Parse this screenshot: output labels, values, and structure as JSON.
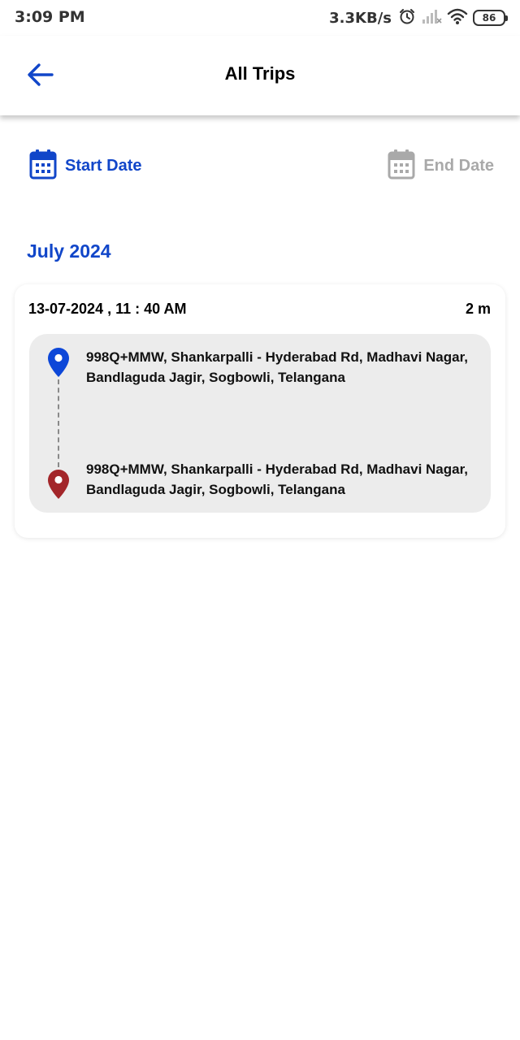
{
  "status_bar": {
    "time": "3:09 PM",
    "network_speed": "3.3KB/s",
    "battery": "86"
  },
  "header": {
    "title": "All Trips"
  },
  "filters": {
    "start_label": "Start Date",
    "end_label": "End Date"
  },
  "month": "July 2024",
  "trip": {
    "datetime": "13-07-2024 , 11 : 40 AM",
    "duration": "2 m",
    "start_address": "998Q+MMW, Shankarpalli - Hyderabad Rd, Madhavi Nagar, Bandlaguda Jagir, Sogbowli, Telangana",
    "end_address": "998Q+MMW, Shankarpalli - Hyderabad Rd, Madhavi Nagar, Bandlaguda Jagir, Sogbowli, Telangana"
  },
  "colors": {
    "accent": "#1146c9",
    "disabled": "#a9a9a9",
    "start_pin": "#0d47d8",
    "end_pin": "#a3262a",
    "route_bg": "#ececec"
  },
  "icons": {
    "back": "arrow-left-icon",
    "start_calendar": "calendar-icon",
    "end_calendar": "calendar-icon",
    "start_pin": "map-pin-icon",
    "end_pin": "map-pin-icon",
    "alarm": "alarm-icon",
    "signal": "signal-icon",
    "wifi": "wifi-icon"
  }
}
